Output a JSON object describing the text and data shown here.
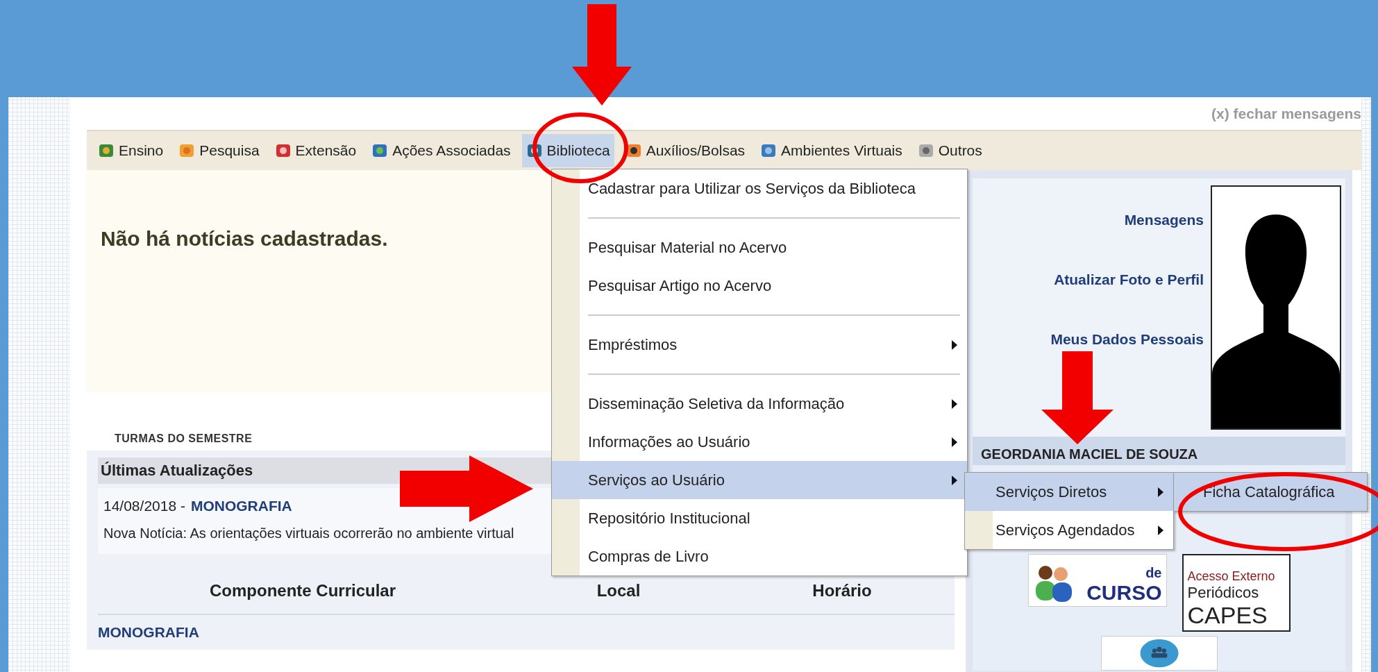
{
  "close_messages": "(x) fechar mensagens",
  "menu_bar": [
    {
      "label": "Ensino",
      "selected": false
    },
    {
      "label": "Pesquisa",
      "selected": false
    },
    {
      "label": "Extensão",
      "selected": false
    },
    {
      "label": "Ações Associadas",
      "selected": false
    },
    {
      "label": "Biblioteca",
      "selected": true
    },
    {
      "label": "Auxílios/Bolsas",
      "selected": false
    },
    {
      "label": "Ambientes Virtuais",
      "selected": false
    },
    {
      "label": "Outros",
      "selected": false
    }
  ],
  "dropdown": {
    "groups": [
      [
        {
          "label": "Cadastrar para Utilizar os Serviços da Biblioteca",
          "has_submenu": false,
          "selected": false
        }
      ],
      [
        {
          "label": "Pesquisar Material no Acervo",
          "has_submenu": false,
          "selected": false
        },
        {
          "label": "Pesquisar Artigo no Acervo",
          "has_submenu": false,
          "selected": false
        }
      ],
      [
        {
          "label": "Empréstimos",
          "has_submenu": true,
          "selected": false
        }
      ],
      [
        {
          "label": "Disseminação Seletiva da Informação",
          "has_submenu": true,
          "selected": false
        },
        {
          "label": "Informações ao Usuário",
          "has_submenu": true,
          "selected": false
        },
        {
          "label": "Serviços ao Usuário",
          "has_submenu": true,
          "selected": true
        },
        {
          "label": "Repositório Institucional",
          "has_submenu": false,
          "selected": false
        },
        {
          "label": "Compras de Livro",
          "has_submenu": false,
          "selected": false
        }
      ]
    ]
  },
  "submenu": [
    {
      "label": "Serviços Diretos",
      "has_submenu": true,
      "selected": true
    },
    {
      "label": "Serviços Agendados",
      "has_submenu": true,
      "selected": false
    }
  ],
  "submenu_2": [
    {
      "label": "Ficha Catalográfica",
      "has_submenu": false,
      "selected": true
    }
  ],
  "news": {
    "empty_text": "Não há notícias cadastradas."
  },
  "classes": {
    "title": "TURMAS DO SEMESTRE",
    "updates": {
      "title": "Últimas Atualizações",
      "date": "14/08/2018 -",
      "link": "MONOGRAFIA",
      "text": "Nova Notícia: As orientações virtuais ocorrerão no ambiente virtual"
    },
    "table": {
      "columns": [
        "Componente Curricular",
        "Local",
        "Horário"
      ],
      "rows": [
        [
          "MONOGRAFIA",
          "",
          ""
        ]
      ]
    }
  },
  "profile": {
    "links": [
      "Mensagens",
      "Atualizar Foto e Perfil",
      "Meus Dados Pessoais"
    ],
    "name": "GEORDANIA MACIEL DE SOUZA",
    "logos": {
      "course": [
        "de",
        "CURSO"
      ],
      "capes": [
        "Acesso Externo",
        "Periódicos",
        "CAPES"
      ]
    }
  }
}
